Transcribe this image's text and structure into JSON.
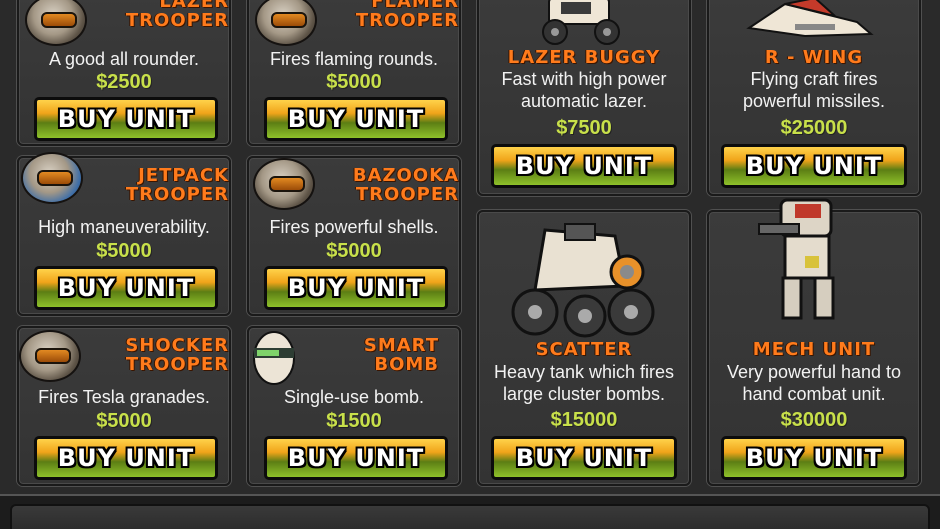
{
  "units": [
    {
      "id": "lazer-trooper",
      "title_line1": "LAZER",
      "title_line2": "TROOPER",
      "desc_line1": "A good all rounder.",
      "desc_line2": "",
      "price": "$2500",
      "button": "BUY UNIT"
    },
    {
      "id": "flamer-trooper",
      "title_line1": "FLAMER",
      "title_line2": "TROOPER",
      "desc_line1": "Fires flaming rounds.",
      "desc_line2": "",
      "price": "$5000",
      "button": "BUY UNIT"
    },
    {
      "id": "lazer-buggy",
      "title_line1": "LAZER BUGGY",
      "title_line2": "",
      "desc_line1": "Fast with high power",
      "desc_line2": "automatic lazer.",
      "price": "$7500",
      "button": "BUY UNIT"
    },
    {
      "id": "r-wing",
      "title_line1": "R - WING",
      "title_line2": "",
      "desc_line1": "Flying craft fires",
      "desc_line2": "powerful missiles.",
      "price": "$25000",
      "button": "BUY UNIT"
    },
    {
      "id": "jetpack-trooper",
      "title_line1": "JETPACK",
      "title_line2": "TROOPER",
      "desc_line1": "High maneuverability.",
      "desc_line2": "",
      "price": "$5000",
      "button": "BUY UNIT"
    },
    {
      "id": "bazooka-trooper",
      "title_line1": "BAZOOKA",
      "title_line2": "TROOPER",
      "desc_line1": "Fires powerful shells.",
      "desc_line2": "",
      "price": "$5000",
      "button": "BUY UNIT"
    },
    {
      "id": "shocker-trooper",
      "title_line1": "SHOCKER",
      "title_line2": "TROOPER",
      "desc_line1": "Fires Tesla granades.",
      "desc_line2": "",
      "price": "$5000",
      "button": "BUY UNIT"
    },
    {
      "id": "smart-bomb",
      "title_line1": "SMART",
      "title_line2": "BOMB",
      "desc_line1": "Single-use bomb.",
      "desc_line2": "",
      "price": "$1500",
      "button": "BUY UNIT"
    },
    {
      "id": "scatter",
      "title_line1": "SCATTER",
      "title_line2": "",
      "desc_line1": "Heavy tank which fires",
      "desc_line2": "large cluster bombs.",
      "price": "$15000",
      "button": "BUY UNIT"
    },
    {
      "id": "mech-unit",
      "title_line1": "MECH UNIT",
      "title_line2": "",
      "desc_line1": "Very powerful hand to",
      "desc_line2": "hand combat unit.",
      "price": "$30000",
      "button": "BUY UNIT"
    }
  ],
  "colors": {
    "title": "#ff7b1c",
    "price": "#c8e04a",
    "desc": "#f2f2f2",
    "panel": "#3b3b3b",
    "background": "#2a2a2a"
  }
}
